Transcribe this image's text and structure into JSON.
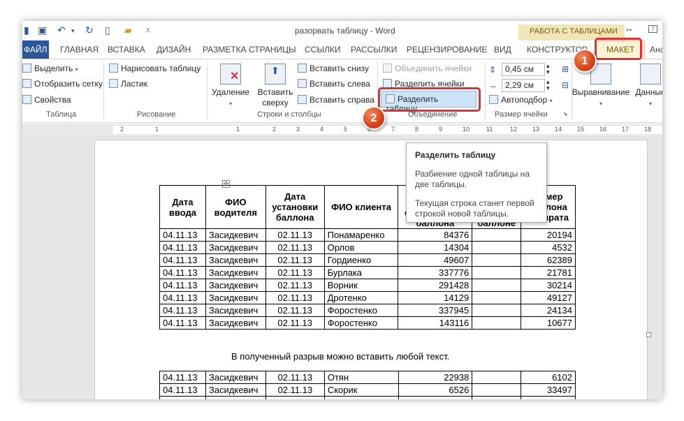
{
  "title_bar": {
    "document_title": "разорвать таблицу - Word",
    "context_group": "РАБОТА С ТАБЛИЦАМИ",
    "resize_glyph": "↔",
    "help_glyph": "?"
  },
  "tabs": {
    "file": "ФАЙЛ",
    "items": [
      "ГЛАВНАЯ",
      "ВСТАВКА",
      "ДИЗАЙН",
      "РАЗМЕТКА СТРАНИЦЫ",
      "ССЫЛКИ",
      "РАССЫЛКИ",
      "РЕЦЕНЗИРОВАНИЕ",
      "ВИД",
      "КОНСТРУКТОР"
    ],
    "active": "МАКЕТ",
    "overflow": "Ана"
  },
  "ribbon": {
    "table_group": {
      "label": "Таблица",
      "select": "Выделить",
      "gridlines": "Отобразить сетку",
      "properties": "Свойства"
    },
    "draw_group": {
      "label": "Рисование",
      "draw_table": "Нарисовать таблицу",
      "eraser": "Ластик"
    },
    "rows_group": {
      "label": "Строки и столбцы",
      "delete": "Удаление",
      "insert_above_line1": "Вставить",
      "insert_above_line2": "сверху",
      "insert_below": "Вставить снизу",
      "insert_left": "Вставить слева",
      "insert_right": "Вставить справа"
    },
    "merge_group": {
      "label": "Объединение",
      "merge_cells": "Объединить ячейки",
      "split_cells": "Разделить ячейки",
      "split_table": "Разделить таблицу"
    },
    "size_group": {
      "label": "Размер ячейки",
      "height": "0,45 см",
      "width": "2,29 см",
      "autofit": "Автоподбор"
    },
    "alignment": "Выравнивание",
    "data": "Данные"
  },
  "ruler": {
    "ticks": [
      "2",
      "1",
      "1",
      "2",
      "3",
      "4",
      "5",
      "6",
      "7",
      "8",
      "9",
      "10",
      "11",
      "12",
      "13",
      "14",
      "15",
      "16",
      "17",
      "18"
    ]
  },
  "tooltip": {
    "title": "Разделить таблицу",
    "line1": "Разбиение одной таблицы на две таблицы.",
    "line2": "Текущая строка станет первой строкой новой таблицы."
  },
  "callouts": {
    "step1": "1",
    "step2": "2"
  },
  "table1": {
    "headers": [
      "Дата ввода",
      "ФИО водителя",
      "Дата установки баллона",
      "ФИО клиента",
      "отгруженного баллона",
      "пломбы на баллоне",
      "Номер баллона возврата"
    ],
    "rows": [
      [
        "04.11.13",
        "Засидкевич",
        "02.11.13",
        "Понамаренко",
        "84376",
        "",
        "20194"
      ],
      [
        "04.11.13",
        "Засидкевич",
        "02.11.13",
        "Орлов",
        "14304",
        "",
        "4532"
      ],
      [
        "04.11.13",
        "Засидкевич",
        "02.11.13",
        "Гордиенко",
        "49607",
        "",
        "62389"
      ],
      [
        "04.11.13",
        "Засидкевич",
        "02.11.13",
        "Бурлака",
        "337776",
        "",
        "21781"
      ],
      [
        "04.11.13",
        "Засидкевич",
        "02.11.13",
        "Ворник",
        "291428",
        "",
        "30214"
      ],
      [
        "04.11.13",
        "Засидкевич",
        "02.11.13",
        "Дротенко",
        "14129",
        "",
        "49127"
      ],
      [
        "04.11.13",
        "Засидкевич",
        "02.11.13",
        "Форостенко",
        "337945",
        "",
        "24134"
      ],
      [
        "04.11.13",
        "Засидкевич",
        "02.11.13",
        "Форостенко",
        "143116",
        "",
        "10677"
      ]
    ]
  },
  "between_text": "В полученный разрыв можно вставить любой текст.",
  "table2": {
    "rows": [
      [
        "04.11.13",
        "Засидкевич",
        "02.11.13",
        "Отян",
        "22938",
        "",
        "6102"
      ],
      [
        "04.11.13",
        "Засидкевич",
        "02.11.13",
        "Скорик",
        "6526",
        "",
        "33497"
      ],
      [
        "",
        "",
        "",
        "",
        "",
        "",
        ""
      ]
    ]
  },
  "colors": {
    "file_tab": "#2b579a",
    "callout_red": "#d8323d",
    "context_band": "#f2e6b8"
  }
}
